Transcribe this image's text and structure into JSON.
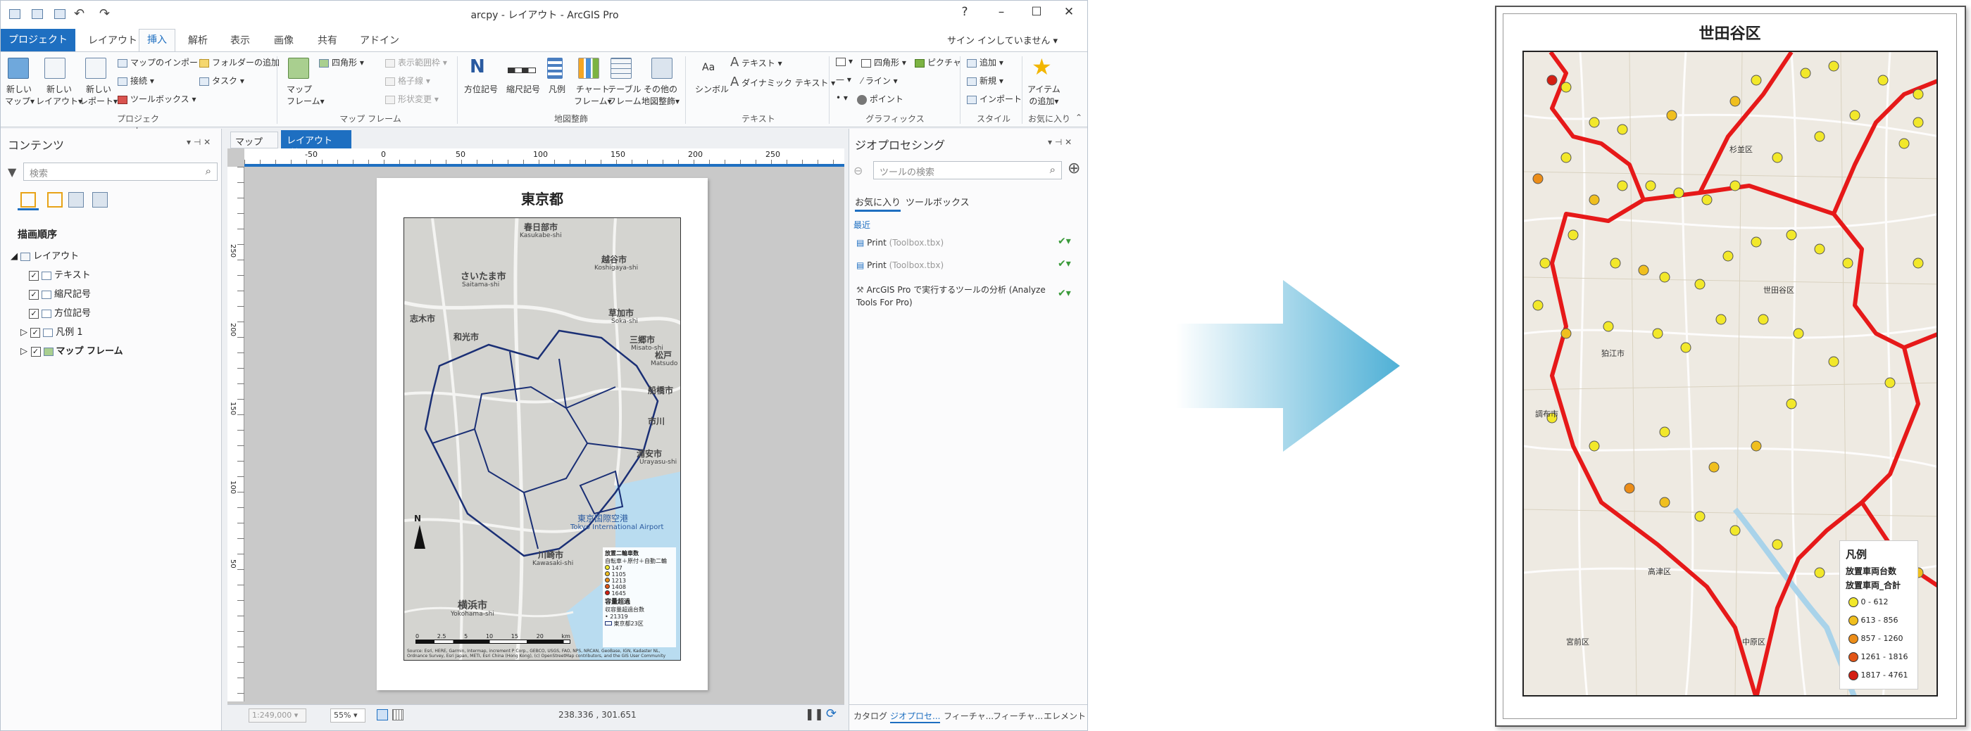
{
  "window": {
    "title": "arcpy - レイアウト - ArcGIS Pro",
    "help": "?",
    "minimize": "–",
    "maximize": "☐",
    "close": "✕"
  },
  "ribbon_tabs": [
    "プロジェクト",
    "レイアウト",
    "挿入",
    "解析",
    "表示",
    "画像",
    "共有",
    "アドイン"
  ],
  "signin": "サイン インしていません ▾",
  "ribbon": {
    "project": {
      "new_map": "新しい\nマップ▾",
      "new_layout": "新しい\nレイアウト▾",
      "new_report": "新しい\nレポート▾",
      "import_map": "マップのインポート",
      "add_folder": "フォルダーの追加",
      "connect": "接続 ▾",
      "task": "タスク ▾",
      "toolbox": "ツールボックス ▾",
      "group": "プロジェクト"
    },
    "mapframe": {
      "map_frame": "マップ\nフレーム▾",
      "rectangle": "四角形 ▾",
      "show_extent": "表示範囲枠 ▾",
      "grid": "格子線 ▾",
      "reshape": "形状変更 ▾",
      "group": "マップ フレーム"
    },
    "surround": {
      "north_arrow": "方位記号",
      "scale_bar": "縮尺記号",
      "legend": "凡例",
      "chart_frame": "チャート\nフレーム▾",
      "table_frame": "テーブル\nフレーム",
      "other": "その他の\n地図整飾▾",
      "group": "地図整飾"
    },
    "text": {
      "symbol": "シンボル",
      "text": "テキスト ▾",
      "dynamic_text": "ダイナミック テキスト ▾",
      "group": "テキスト"
    },
    "graphics": {
      "rect": "四角形 ▾",
      "picture": "ピクチャ",
      "line": "ライン ▾",
      "point": "ポイント",
      "group": "グラフィックス"
    },
    "style": {
      "add": "追加 ▾",
      "new": "新規 ▾",
      "import": "インポート",
      "group": "スタイル"
    },
    "favorites": {
      "add_item": "アイテム\nの追加▾",
      "group": "お気に入り"
    }
  },
  "contents": {
    "title": "コンテンツ",
    "search_placeholder": "検索",
    "section": "描画順序",
    "items": [
      {
        "label": "レイアウト",
        "bold": false
      },
      {
        "label": "テキスト",
        "bold": false
      },
      {
        "label": "縮尺記号",
        "bold": false
      },
      {
        "label": "方位記号",
        "bold": false
      },
      {
        "label": "凡例 1",
        "bold": false
      },
      {
        "label": "マップ フレーム",
        "bold": true
      }
    ]
  },
  "view_tabs": [
    "マップ",
    "レイアウト"
  ],
  "ruler": {
    "h": [
      "-50",
      "0",
      "50",
      "100",
      "150",
      "200",
      "250"
    ],
    "v": [
      "250",
      "200",
      "150",
      "100",
      "50"
    ]
  },
  "layout_page": {
    "title": "東京都",
    "map_labels": [
      "春日部市",
      "Kasukabe-shi",
      "越谷市",
      "Koshigaya-shi",
      "さいたま市",
      "Saitama-shi",
      "草加市",
      "Soka-shi",
      "志木市",
      "和光市",
      "三郷市",
      "Misato-shi",
      "松戸",
      "Matsudo",
      "市川",
      "浦安市",
      "Urayasu-shi",
      "船橋市",
      "東京国際空港",
      "Tokyo International Airport",
      "川崎市",
      "Kawasaki-shi",
      "横浜市",
      "Yokohama-shi"
    ],
    "legend": {
      "title": "放置二輪車数",
      "subtitle": "自転車＋原付＋自動二輪",
      "classes": [
        "147",
        "1105",
        "1213",
        "1408",
        "1645"
      ],
      "sub2": "容量超過",
      "sub3": "収容量超過台数",
      "items2": [
        "21319",
        "東京都23区"
      ]
    },
    "scalebar": [
      "0",
      "2.5",
      "5",
      "10",
      "15",
      "20",
      "km"
    ],
    "credit": "Source: Esri, HERE, Garmin, Intermap, increment P Corp., GEBCO, USGS, FAO, NPS, NRCAN, GeoBase, IGN, Kadaster NL, Ordnance Survey, Esri Japan, METI, Esri China (Hong Kong), (c) OpenStreetMap contributors, and the GIS User Community"
  },
  "statusbar": {
    "scale": "1:249,000",
    "zoom": "55%",
    "coords": "238.336 , 301.651"
  },
  "geoprocessing": {
    "title": "ジオプロセシング",
    "search_placeholder": "ツールの検索",
    "tabs": [
      "お気に入り",
      "ツールボックス"
    ],
    "section": "最近",
    "items": [
      {
        "name": "Print",
        "sub": "(Toolbox.tbx)"
      },
      {
        "name": "Print",
        "sub": "(Toolbox.tbx)"
      },
      {
        "name": "ArcGIS Pro で実行するツールの分析 (Analyze Tools For Pro)",
        "sub": ""
      }
    ],
    "bottom_tabs": [
      "カタログ",
      "ジオプロセ...",
      "フィーチャ...",
      "フィーチャ...",
      "エレメント"
    ]
  },
  "right_map": {
    "title": "世田谷区",
    "labels": [
      "杉並区",
      "世田谷区",
      "狛江市",
      "調布市",
      "高津区",
      "中原区",
      "宮前区"
    ],
    "legend": {
      "title": "凡例",
      "sub1": "放置車両台数",
      "sub2": "放置車両_合計",
      "classes": [
        "0 - 612",
        "613 - 856",
        "857 - 1260",
        "1261 - 1816",
        "1817 - 4761"
      ]
    },
    "class_colors": [
      "#f2e82a",
      "#f0bf1e",
      "#ec8d18",
      "#e25516",
      "#d41e12"
    ]
  },
  "colors": {
    "accent": "#1e6fc1",
    "arrow": "#4fb0d6",
    "boundary_red": "#e61919",
    "boundary_navy": "#1a2f75",
    "water": "#b9dcf0"
  }
}
